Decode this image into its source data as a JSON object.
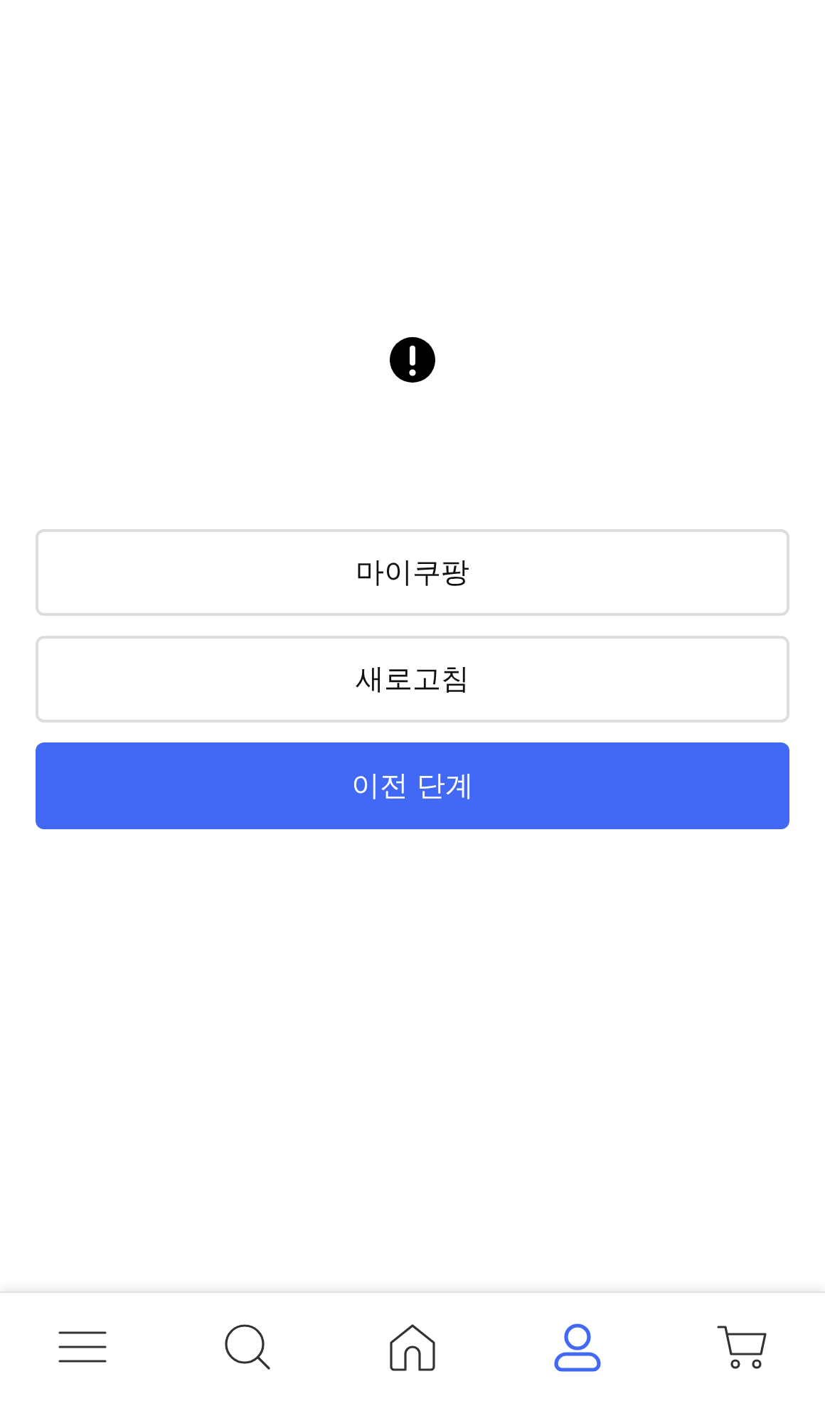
{
  "buttons": [
    {
      "label": "마이쿠팡",
      "kind": "outline"
    },
    {
      "label": "새로고침",
      "kind": "outline"
    },
    {
      "label": "이전 단계",
      "kind": "primary"
    }
  ],
  "nav": [
    {
      "kind": "menu",
      "selected": false
    },
    {
      "kind": "search",
      "selected": false
    },
    {
      "kind": "home",
      "selected": false
    },
    {
      "kind": "account",
      "selected": true
    },
    {
      "kind": "cart",
      "selected": false
    }
  ]
}
